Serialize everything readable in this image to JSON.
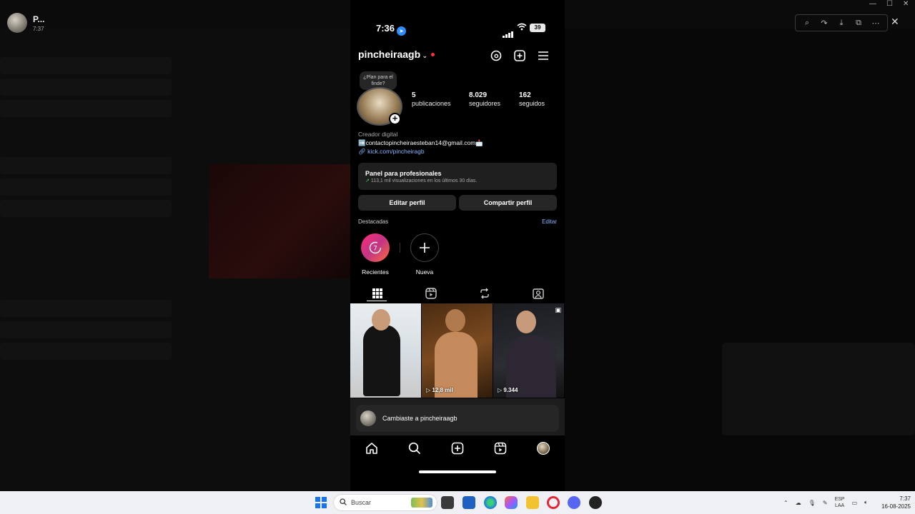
{
  "viewer": {
    "user_name": "P...",
    "user_time": "7:37",
    "tools": [
      "zoom-icon",
      "rotate-icon",
      "download-icon",
      "open-icon",
      "more-icon"
    ],
    "close": "✕"
  },
  "phone": {
    "status": {
      "time": "7:36",
      "battery": "39"
    },
    "header": {
      "username": "pincheiraagb"
    },
    "note": "¿Plan para el finde?",
    "stats": [
      {
        "value": "5",
        "label": "publicaciones"
      },
      {
        "value": "8.029",
        "label": "seguidores"
      },
      {
        "value": "162",
        "label": "seguidos"
      }
    ],
    "bio": {
      "category": "Creador digital",
      "line": "➡️contactopincheiraesteban14@gmail.com📩",
      "link": "kick.com/pincheiragb"
    },
    "pro_panel": {
      "title": "Panel para profesionales",
      "subtitle": "113,1 mil visualizaciones en los últimos 30 días."
    },
    "buttons": {
      "edit": "Editar perfil",
      "share": "Compartir perfil"
    },
    "highlights": {
      "title": "Destacadas",
      "edit": "Editar",
      "items": [
        {
          "label": "Recientes"
        },
        {
          "label": "Nueva"
        }
      ]
    },
    "posts": [
      {
        "count": ""
      },
      {
        "count": "12,8 mil"
      },
      {
        "count": "9.344"
      }
    ],
    "toast": "Cambiaste a pincheiraagb",
    "colors": {
      "accent": "#8ab4ff",
      "live_dot": "#ff3040"
    }
  },
  "taskbar": {
    "search_placeholder": "Buscar",
    "lang_top": "ESP",
    "lang_bottom": "LAA",
    "time": "7:37",
    "date": "16-08-2025"
  }
}
